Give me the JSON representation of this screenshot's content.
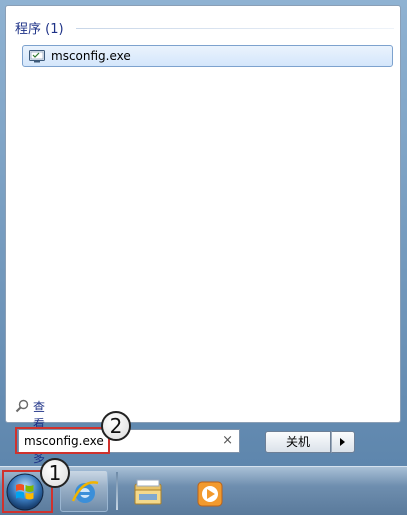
{
  "start_menu": {
    "programs_group": {
      "title": "程序 (1)",
      "results": [
        {
          "label": "msconfig.exe",
          "icon": "msconfig-app-icon"
        }
      ]
    },
    "see_more": {
      "label": "查看更多结果",
      "icon": "magnifier-icon"
    },
    "search": {
      "value": "msconfig.exe",
      "clear_glyph": "×"
    },
    "shutdown": {
      "label": "关机",
      "arrow_icon": "triangle-right-icon"
    }
  },
  "annotations": [
    {
      "number": "1",
      "target": "start-button"
    },
    {
      "number": "2",
      "target": "search-input"
    }
  ],
  "taskbar": {
    "items": [
      {
        "name": "start-button",
        "icon": "windows-orb-icon"
      },
      {
        "name": "internet-explorer",
        "icon": "ie-icon"
      },
      {
        "name": "windows-explorer",
        "icon": "folder-icon"
      },
      {
        "name": "media-player",
        "icon": "media-player-icon"
      }
    ]
  },
  "colors": {
    "annotation_red": "#d0322d",
    "group_title_blue": "#1e3287",
    "selection_border": "#7da2ce"
  }
}
